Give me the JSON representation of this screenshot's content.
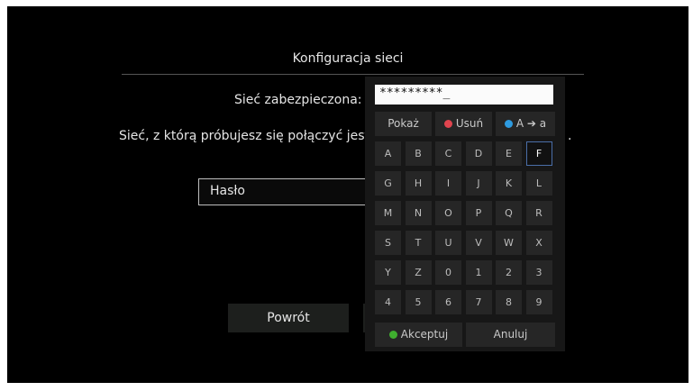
{
  "dialog": {
    "title": "Konfiguracja sieci",
    "security_label": "Sieć zabezpieczona:",
    "message": "Sieć, z którą próbujesz się połączyć jest za",
    "message_tail": ".",
    "password_placeholder": "Hasło",
    "back_label": "Powrót"
  },
  "keyboard": {
    "input_value": "*********_",
    "show_label": "Pokaż",
    "delete_label": "Usuń",
    "case_label": "A ➔ a",
    "accept_label": "Akceptuj",
    "cancel_label": "Anuluj",
    "keys": [
      "A",
      "B",
      "C",
      "D",
      "E",
      "F",
      "G",
      "H",
      "I",
      "J",
      "K",
      "L",
      "M",
      "N",
      "O",
      "P",
      "Q",
      "R",
      "S",
      "T",
      "U",
      "V",
      "W",
      "X",
      "Y",
      "Z",
      "0",
      "1",
      "2",
      "3",
      "4",
      "5",
      "6",
      "7",
      "8",
      "9"
    ],
    "focused_key": "F"
  },
  "colors": {
    "delete_dot": "#e0444e",
    "case_dot": "#2e9be0",
    "accept_dot": "#3fae2f",
    "focus_border": "#4a6ea8"
  }
}
